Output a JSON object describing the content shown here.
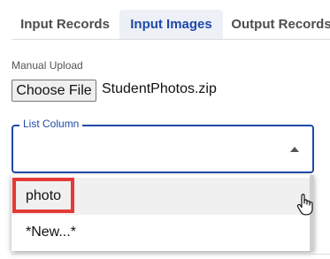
{
  "tabs": [
    {
      "label": "Input Records"
    },
    {
      "label": "Input Images"
    },
    {
      "label": "Output Records"
    }
  ],
  "upload": {
    "label": "Manual Upload",
    "button_label": "Choose File",
    "file_name": "StudentPhotos.zip"
  },
  "list_column": {
    "label": "List Column",
    "value": "",
    "options": [
      {
        "label": "photo"
      },
      {
        "label": "*New...*"
      }
    ]
  },
  "colors": {
    "accent": "#1f49a8",
    "highlight_outline": "#e53935",
    "hovered_option_bg": "#f0f0f0"
  },
  "icons": {
    "cursor": "hand-pointer-icon",
    "select_caret": "caret-up-icon"
  }
}
